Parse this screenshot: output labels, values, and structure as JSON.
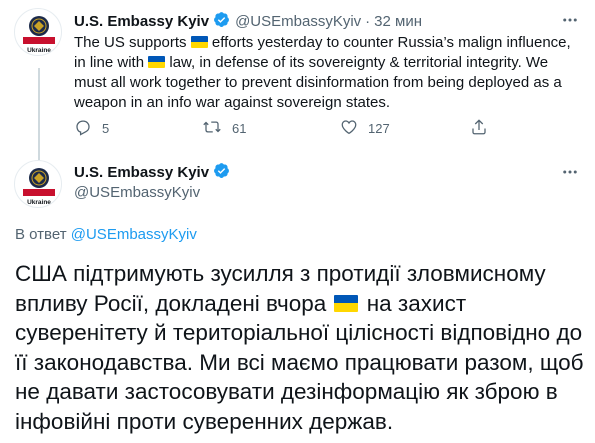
{
  "tweet1": {
    "avatar_label": "Ukraine",
    "name": "U.S. Embassy Kyiv",
    "handle": "@USEmbassyKyiv",
    "separator": "·",
    "time": "32 мин",
    "text_a": "The US supports ",
    "text_b": " efforts yesterday to counter Russia’s malign influence, in line with ",
    "text_c": " law, in defense of its sovereignty & territorial integrity. We must all work together to prevent disinformation from being deployed as a weapon in an info war against sovereign states.",
    "actions": {
      "reply_count": "5",
      "retweet_count": "61",
      "like_count": "127"
    },
    "icons": [
      "more-icon",
      "reply-icon",
      "retweet-icon",
      "like-icon",
      "share-icon",
      "verified-icon"
    ]
  },
  "tweet2": {
    "avatar_label": "Ukraine",
    "name": "U.S. Embassy Kyiv",
    "handle": "@USEmbassyKyiv",
    "reply_prefix": "В ответ ",
    "reply_mention": "@USEmbassyKyiv",
    "text_a": "США підтримують зусилля з протидії зловмисному впливу Росії, докладені вчора ",
    "text_b": " на захист суверенітету й територіальної цілісності відповідно до її законодавства. Ми всі маємо працювати разом, щоб не давати застосовувати дезінформацію як зброю в інфовійні проти суверенних держав."
  },
  "colors": {
    "accent": "#1d9bf0",
    "text": "#0f1419",
    "secondary": "#536471",
    "avatar_red": "#c8102e",
    "flag_blue": "#0057b7",
    "flag_yellow": "#ffd700"
  }
}
